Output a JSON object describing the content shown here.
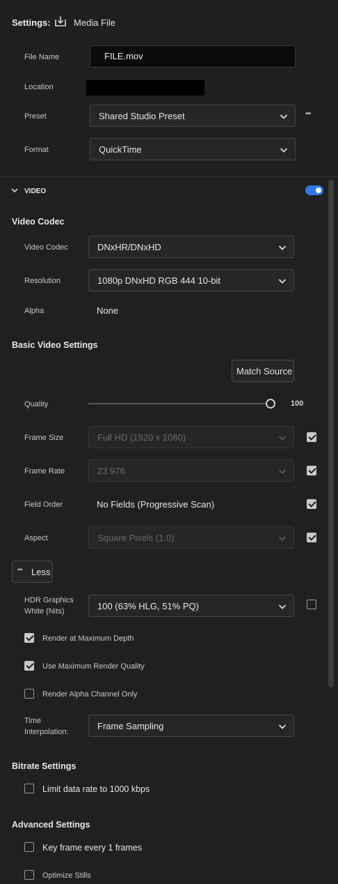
{
  "header": {
    "settings_label": "Settings:",
    "media_file_label": "Media File",
    "file_name_label": "File Name",
    "file_name_value": "FILE.mov",
    "location_label": "Location",
    "preset_label": "Preset",
    "preset_value": "Shared Studio Preset",
    "more_glyph": "•••",
    "format_label": "Format",
    "format_value": "QuickTime"
  },
  "video": {
    "section_label": "VIDEO",
    "toggle_on": true,
    "toggle_color": "#2d7be5",
    "codec_heading": "Video Codec",
    "codec_label": "Video Codec",
    "codec_value": "DNxHR/DNxHD",
    "resolution_label": "Resolution",
    "resolution_value": "1080p DNxHD RGB 444 10-bit",
    "alpha_label": "Alpha",
    "alpha_value": "None",
    "basic_heading": "Basic Video Settings",
    "match_source_label": "Match Source",
    "quality_label": "Quality",
    "quality_value": "100",
    "frame_size_label": "Frame Size",
    "frame_size_value": "Full HD (1920 x 1080)",
    "frame_rate_label": "Frame Rate",
    "frame_rate_value": "23.976",
    "field_order_label": "Field Order",
    "field_order_value": "No Fields (Progressive Scan)",
    "aspect_label": "Aspect",
    "aspect_value": "Square Pixels (1.0)",
    "less_glyph": "•••",
    "less_label": "Less",
    "hdr_label_line1": "HDR Graphics",
    "hdr_label_line2": "White (Nits)",
    "hdr_value": "100 (63% HLG, 51% PQ)",
    "render_max_depth_label": "Render at Maximum Depth",
    "max_render_quality_label": "Use Maximum Render Quality",
    "render_alpha_only_label": "Render Alpha Channel Only",
    "time_interp_line1": "Time",
    "time_interp_line2": "Interpolation:",
    "time_interp_value": "Frame Sampling"
  },
  "bitrate": {
    "heading": "Bitrate Settings",
    "limit_label": "Limit data rate to 1000 kbps"
  },
  "advanced": {
    "heading": "Advanced Settings",
    "keyframe_label": "Key frame every 1 frames",
    "optimize_stills_label": "Optimize Stills"
  },
  "checkboxes": {
    "frame_size": true,
    "frame_rate": true,
    "field_order": true,
    "aspect": true,
    "hdr": false,
    "render_max_depth": true,
    "max_render_quality": true,
    "render_alpha_only": false,
    "limit_data_rate": false,
    "keyframe": false,
    "optimize_stills": false
  }
}
